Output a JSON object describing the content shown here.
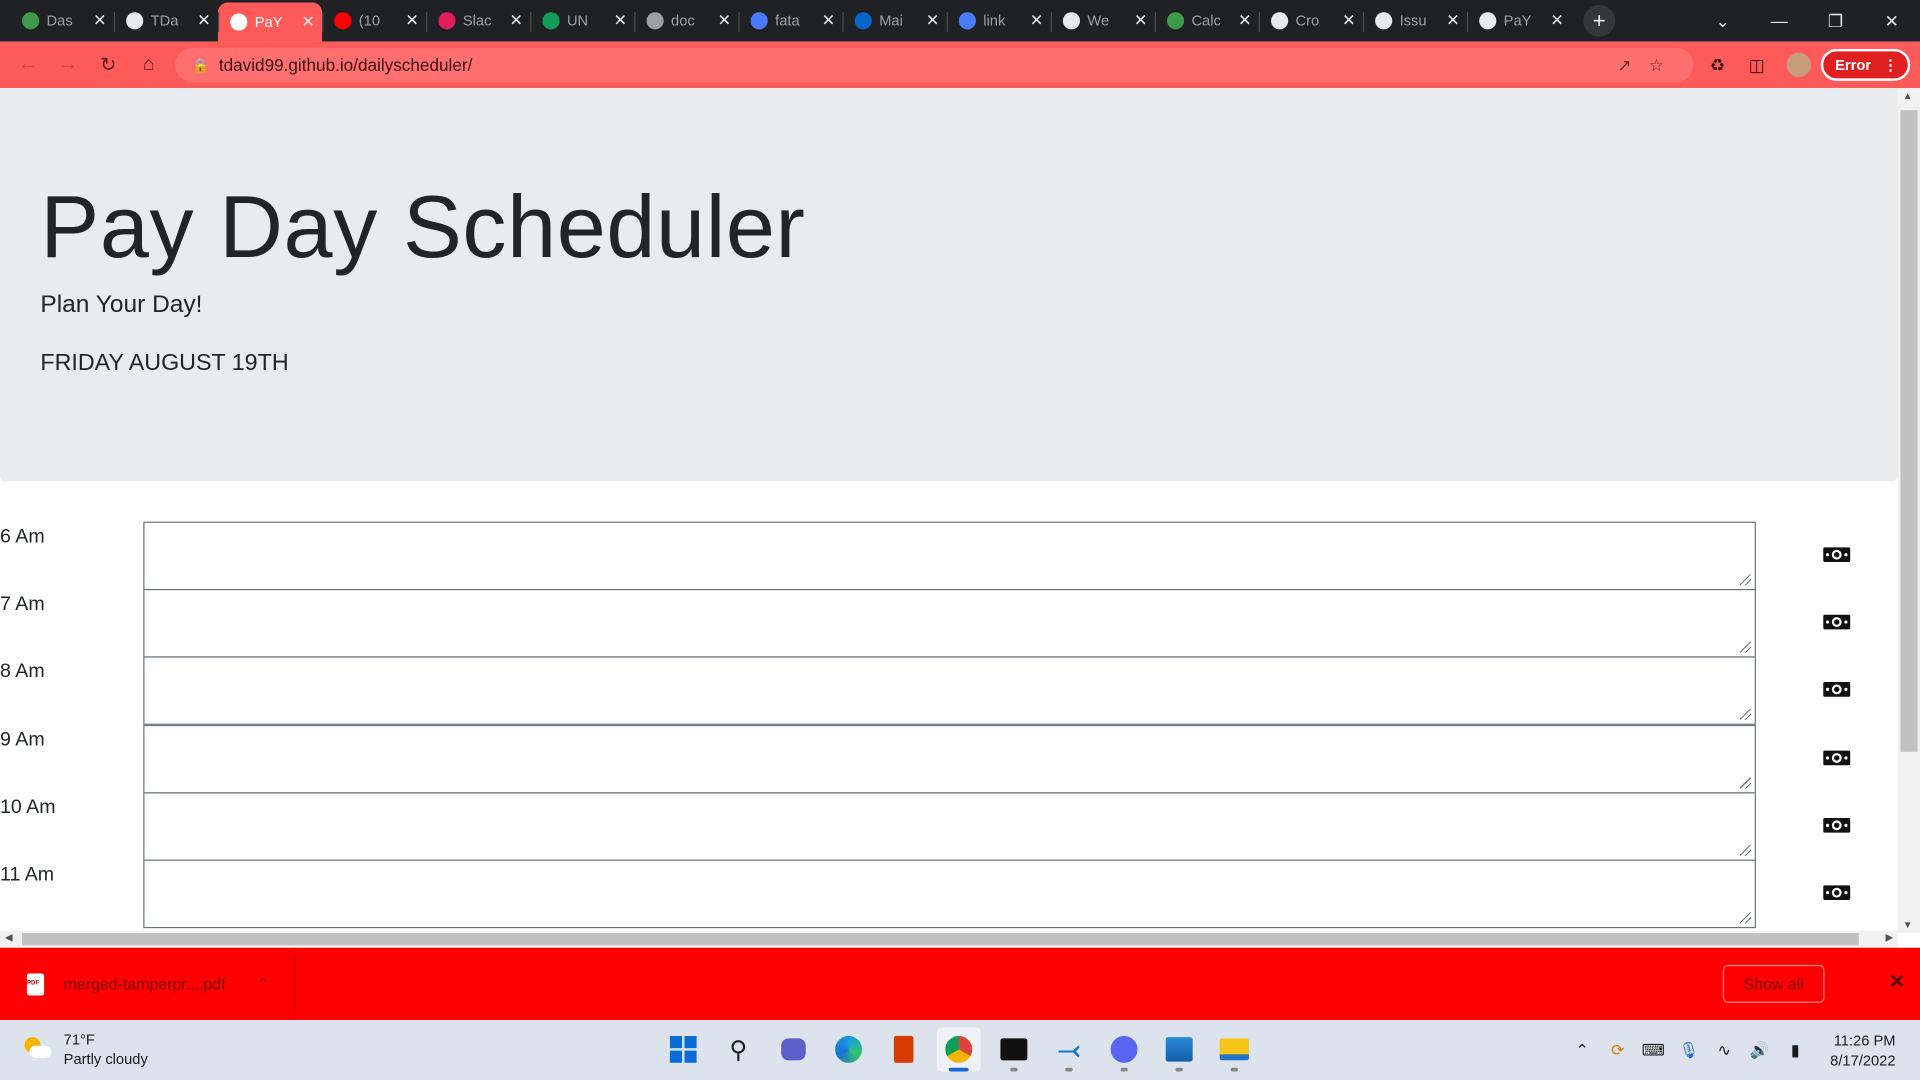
{
  "browser": {
    "tabs": [
      {
        "title": "Das",
        "favicon": "stock-icon",
        "color": "#3c9a4a"
      },
      {
        "title": "TDa",
        "favicon": "github-icon",
        "color": "#e8eaed"
      },
      {
        "title": "PaY",
        "favicon": "globe-icon",
        "color": "#ffffff",
        "active": true
      },
      {
        "title": "(10",
        "favicon": "youtube-icon",
        "color": "#ff0000"
      },
      {
        "title": "Slac",
        "favicon": "slack-icon",
        "color": "#e01e5a"
      },
      {
        "title": "UN",
        "favicon": "plus-icon",
        "color": "#0f9d58"
      },
      {
        "title": "doc",
        "favicon": "oval-icon",
        "color": "#9aa0a6"
      },
      {
        "title": "fata",
        "favicon": "blue-logo-icon",
        "color": "#4a7bff"
      },
      {
        "title": "Mai",
        "favicon": "outlook-icon",
        "color": "#0a64c8"
      },
      {
        "title": "link",
        "favicon": "blue-logo-icon",
        "color": "#4a7bff"
      },
      {
        "title": "We",
        "favicon": "globe-icon",
        "color": "#e8eaed"
      },
      {
        "title": "Calc",
        "favicon": "stock-icon",
        "color": "#3c9a4a"
      },
      {
        "title": "Cro",
        "favicon": "github-icon",
        "color": "#e8eaed"
      },
      {
        "title": "Issu",
        "favicon": "github-icon",
        "color": "#e8eaed"
      },
      {
        "title": "PaY",
        "favicon": "globe-icon",
        "color": "#e8eaed"
      }
    ],
    "url": "tdavid99.github.io/dailyscheduler/",
    "error_label": "Error"
  },
  "page": {
    "title": "Pay Day Scheduler",
    "subtitle": "Plan Your Day!",
    "date": "FRIDAY AUGUST 19TH",
    "rows": [
      {
        "hour": "6 Am",
        "value": ""
      },
      {
        "hour": "7 Am",
        "value": ""
      },
      {
        "hour": "8 Am",
        "value": ""
      },
      {
        "hour": "9 Am",
        "value": ""
      },
      {
        "hour": "10 Am",
        "value": ""
      },
      {
        "hour": "11 Am",
        "value": ""
      }
    ],
    "save_icon": "money-bill-icon"
  },
  "download_bar": {
    "filename": "merged-tamperpr....pdf",
    "show_all": "Show all"
  },
  "taskbar": {
    "temperature": "71°F",
    "condition": "Partly cloudy",
    "time": "11:26 PM",
    "date": "8/17/2022"
  },
  "colors": {
    "chrome_theme": "#ff5a5a",
    "download_bar": "#ff0000",
    "jumbotron": "#e9ecef"
  }
}
